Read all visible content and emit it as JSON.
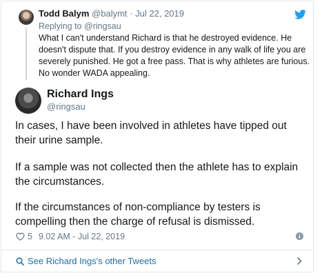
{
  "parent_tweet": {
    "name": "Todd Balym",
    "handle": "@balymt",
    "separator": "·",
    "date": "Jul 22, 2019",
    "replying_to": "Replying to @ringsau",
    "text": "What I can't understand Richard is that he destroyed evidence. He doesn't dispute that. If you destroy evidence in any walk of life you are severely punished. He got a free pass. That is why athletes are furious. No wonder WADA appealing."
  },
  "main_tweet": {
    "name": "Richard Ings",
    "handle": "@ringsau",
    "paragraphs": [
      "In cases, I have been involved in athletes have tipped out their urine sample.",
      "If a sample was not collected then the athlete has to explain the circumstances.",
      "If the circumstances of non-compliance by testers is compelling then the charge of refusal is dismissed."
    ],
    "likes": "5",
    "timestamp": "9.02 AM - Jul 22, 2019"
  },
  "footer": {
    "see_more_label": "See Richard Ings's other Tweets"
  },
  "colors": {
    "brand": "#1da1f2",
    "link": "#1b6ea8",
    "muted": "#657786",
    "border": "#e1e8ed"
  },
  "icons": [
    "twitter-bird-icon",
    "heart-icon",
    "info-icon",
    "search-icon",
    "chevron-right-icon"
  ]
}
